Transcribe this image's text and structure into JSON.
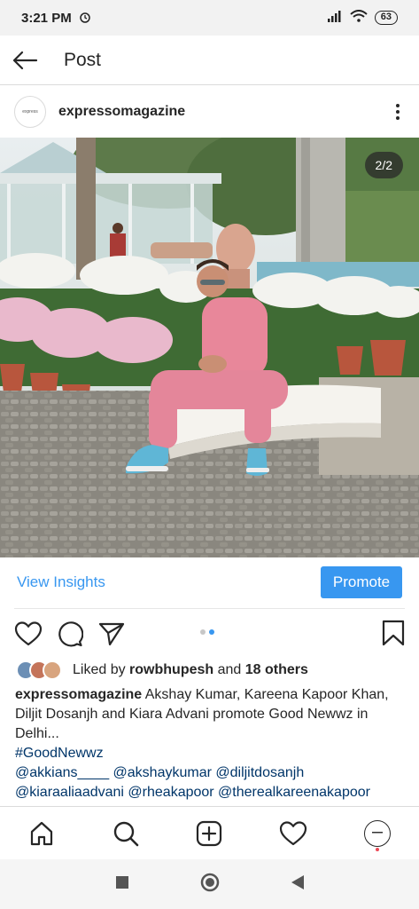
{
  "status_bar": {
    "time": "3:21 PM",
    "battery": "63"
  },
  "header": {
    "title": "Post"
  },
  "post": {
    "username": "expressomagazine",
    "image_counter": "2/2",
    "avatar_text": "express"
  },
  "insights": {
    "link_label": "View Insights",
    "promote_label": "Promote"
  },
  "likes": {
    "prefix": "Liked by",
    "user": "rowbhupesh",
    "and": "and",
    "others": "18 others"
  },
  "caption": {
    "username": "expressomagazine",
    "text": "Akshay Kumar, Kareena Kapoor Khan, Diljit Dosanjh and Kiara Advani promote Good Newwz in Delhi...",
    "hashtag": "#GoodNewwz",
    "mentions_line1": "@akkians____ @akshaykumar @diljitdosanjh",
    "mentions_line2": "@kiaraaliaadvani @rheakapoor @therealkareenakapoor"
  },
  "colors": {
    "accent": "#3897f0",
    "text": "#262626",
    "link": "#003569"
  },
  "icons": [
    "back-arrow-icon",
    "more-options-icon",
    "heart-icon",
    "comment-icon",
    "send-icon",
    "bookmark-icon",
    "home-icon",
    "search-icon",
    "add-post-icon",
    "activity-icon",
    "profile-icon",
    "recents-icon",
    "home-circle-icon",
    "back-triangle-icon"
  ]
}
